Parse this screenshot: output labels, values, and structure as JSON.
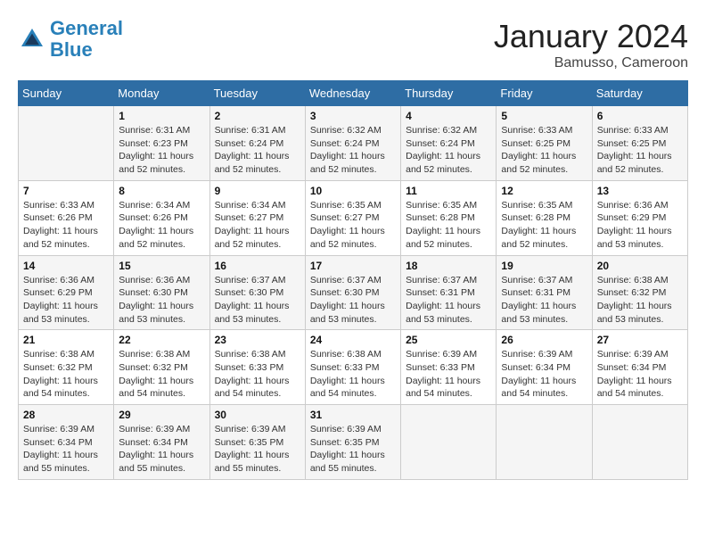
{
  "logo": {
    "line1": "General",
    "line2": "Blue"
  },
  "title": "January 2024",
  "location": "Bamusso, Cameroon",
  "days_header": [
    "Sunday",
    "Monday",
    "Tuesday",
    "Wednesday",
    "Thursday",
    "Friday",
    "Saturday"
  ],
  "weeks": [
    [
      {
        "day": "",
        "sunrise": "",
        "sunset": "",
        "daylight": ""
      },
      {
        "day": "1",
        "sunrise": "Sunrise: 6:31 AM",
        "sunset": "Sunset: 6:23 PM",
        "daylight": "Daylight: 11 hours and 52 minutes."
      },
      {
        "day": "2",
        "sunrise": "Sunrise: 6:31 AM",
        "sunset": "Sunset: 6:24 PM",
        "daylight": "Daylight: 11 hours and 52 minutes."
      },
      {
        "day": "3",
        "sunrise": "Sunrise: 6:32 AM",
        "sunset": "Sunset: 6:24 PM",
        "daylight": "Daylight: 11 hours and 52 minutes."
      },
      {
        "day": "4",
        "sunrise": "Sunrise: 6:32 AM",
        "sunset": "Sunset: 6:24 PM",
        "daylight": "Daylight: 11 hours and 52 minutes."
      },
      {
        "day": "5",
        "sunrise": "Sunrise: 6:33 AM",
        "sunset": "Sunset: 6:25 PM",
        "daylight": "Daylight: 11 hours and 52 minutes."
      },
      {
        "day": "6",
        "sunrise": "Sunrise: 6:33 AM",
        "sunset": "Sunset: 6:25 PM",
        "daylight": "Daylight: 11 hours and 52 minutes."
      }
    ],
    [
      {
        "day": "7",
        "sunrise": "Sunrise: 6:33 AM",
        "sunset": "Sunset: 6:26 PM",
        "daylight": "Daylight: 11 hours and 52 minutes."
      },
      {
        "day": "8",
        "sunrise": "Sunrise: 6:34 AM",
        "sunset": "Sunset: 6:26 PM",
        "daylight": "Daylight: 11 hours and 52 minutes."
      },
      {
        "day": "9",
        "sunrise": "Sunrise: 6:34 AM",
        "sunset": "Sunset: 6:27 PM",
        "daylight": "Daylight: 11 hours and 52 minutes."
      },
      {
        "day": "10",
        "sunrise": "Sunrise: 6:35 AM",
        "sunset": "Sunset: 6:27 PM",
        "daylight": "Daylight: 11 hours and 52 minutes."
      },
      {
        "day": "11",
        "sunrise": "Sunrise: 6:35 AM",
        "sunset": "Sunset: 6:28 PM",
        "daylight": "Daylight: 11 hours and 52 minutes."
      },
      {
        "day": "12",
        "sunrise": "Sunrise: 6:35 AM",
        "sunset": "Sunset: 6:28 PM",
        "daylight": "Daylight: 11 hours and 52 minutes."
      },
      {
        "day": "13",
        "sunrise": "Sunrise: 6:36 AM",
        "sunset": "Sunset: 6:29 PM",
        "daylight": "Daylight: 11 hours and 53 minutes."
      }
    ],
    [
      {
        "day": "14",
        "sunrise": "Sunrise: 6:36 AM",
        "sunset": "Sunset: 6:29 PM",
        "daylight": "Daylight: 11 hours and 53 minutes."
      },
      {
        "day": "15",
        "sunrise": "Sunrise: 6:36 AM",
        "sunset": "Sunset: 6:30 PM",
        "daylight": "Daylight: 11 hours and 53 minutes."
      },
      {
        "day": "16",
        "sunrise": "Sunrise: 6:37 AM",
        "sunset": "Sunset: 6:30 PM",
        "daylight": "Daylight: 11 hours and 53 minutes."
      },
      {
        "day": "17",
        "sunrise": "Sunrise: 6:37 AM",
        "sunset": "Sunset: 6:30 PM",
        "daylight": "Daylight: 11 hours and 53 minutes."
      },
      {
        "day": "18",
        "sunrise": "Sunrise: 6:37 AM",
        "sunset": "Sunset: 6:31 PM",
        "daylight": "Daylight: 11 hours and 53 minutes."
      },
      {
        "day": "19",
        "sunrise": "Sunrise: 6:37 AM",
        "sunset": "Sunset: 6:31 PM",
        "daylight": "Daylight: 11 hours and 53 minutes."
      },
      {
        "day": "20",
        "sunrise": "Sunrise: 6:38 AM",
        "sunset": "Sunset: 6:32 PM",
        "daylight": "Daylight: 11 hours and 53 minutes."
      }
    ],
    [
      {
        "day": "21",
        "sunrise": "Sunrise: 6:38 AM",
        "sunset": "Sunset: 6:32 PM",
        "daylight": "Daylight: 11 hours and 54 minutes."
      },
      {
        "day": "22",
        "sunrise": "Sunrise: 6:38 AM",
        "sunset": "Sunset: 6:32 PM",
        "daylight": "Daylight: 11 hours and 54 minutes."
      },
      {
        "day": "23",
        "sunrise": "Sunrise: 6:38 AM",
        "sunset": "Sunset: 6:33 PM",
        "daylight": "Daylight: 11 hours and 54 minutes."
      },
      {
        "day": "24",
        "sunrise": "Sunrise: 6:38 AM",
        "sunset": "Sunset: 6:33 PM",
        "daylight": "Daylight: 11 hours and 54 minutes."
      },
      {
        "day": "25",
        "sunrise": "Sunrise: 6:39 AM",
        "sunset": "Sunset: 6:33 PM",
        "daylight": "Daylight: 11 hours and 54 minutes."
      },
      {
        "day": "26",
        "sunrise": "Sunrise: 6:39 AM",
        "sunset": "Sunset: 6:34 PM",
        "daylight": "Daylight: 11 hours and 54 minutes."
      },
      {
        "day": "27",
        "sunrise": "Sunrise: 6:39 AM",
        "sunset": "Sunset: 6:34 PM",
        "daylight": "Daylight: 11 hours and 54 minutes."
      }
    ],
    [
      {
        "day": "28",
        "sunrise": "Sunrise: 6:39 AM",
        "sunset": "Sunset: 6:34 PM",
        "daylight": "Daylight: 11 hours and 55 minutes."
      },
      {
        "day": "29",
        "sunrise": "Sunrise: 6:39 AM",
        "sunset": "Sunset: 6:34 PM",
        "daylight": "Daylight: 11 hours and 55 minutes."
      },
      {
        "day": "30",
        "sunrise": "Sunrise: 6:39 AM",
        "sunset": "Sunset: 6:35 PM",
        "daylight": "Daylight: 11 hours and 55 minutes."
      },
      {
        "day": "31",
        "sunrise": "Sunrise: 6:39 AM",
        "sunset": "Sunset: 6:35 PM",
        "daylight": "Daylight: 11 hours and 55 minutes."
      },
      {
        "day": "",
        "sunrise": "",
        "sunset": "",
        "daylight": ""
      },
      {
        "day": "",
        "sunrise": "",
        "sunset": "",
        "daylight": ""
      },
      {
        "day": "",
        "sunrise": "",
        "sunset": "",
        "daylight": ""
      }
    ]
  ]
}
